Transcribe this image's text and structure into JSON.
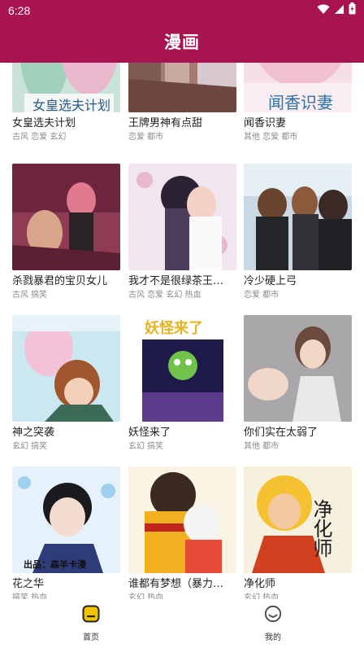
{
  "status": {
    "time": "6:28",
    "wifi_icon": "wifi-icon",
    "signal_icon": "signal-icon",
    "battery_icon": "battery-icon"
  },
  "header": {
    "title": "漫画"
  },
  "colors": {
    "brand": "#a8144f",
    "nav_active": "#f2c400",
    "tag_text": "#8a8a8a"
  },
  "comics": [
    {
      "title": "女皇选夫计划",
      "tags": "古风 恋爱 玄幻"
    },
    {
      "title": "王牌男神有点甜",
      "tags": "恋爱 都市"
    },
    {
      "title": "闻香识妻",
      "tags": "其他 恋爱 都市"
    },
    {
      "title": "杀戮暴君的宝贝女儿",
      "tags": "古风 搞笑"
    },
    {
      "title": "我才不是很绿茶王妃呢",
      "tags": "古风 恋爱 玄幻 热血"
    },
    {
      "title": "冷少硬上弓",
      "tags": "恋爱 都市"
    },
    {
      "title": "神之突袭",
      "tags": "玄幻 搞笑"
    },
    {
      "title": "妖怪来了",
      "tags": "玄幻 搞笑"
    },
    {
      "title": "你们实在太弱了",
      "tags": "其他 都市"
    },
    {
      "title": "花之华",
      "tags": "搞笑 热血"
    },
    {
      "title": "谁都有梦想（暴力兔）",
      "tags": "玄幻 热血"
    },
    {
      "title": "净化师",
      "tags": "玄幻 热血"
    }
  ],
  "covers": {
    "cover_8_text": "妖怪来了",
    "cover_10_text": "出品：森羊卡漫",
    "cover_12_text": "净化师"
  },
  "bottom_nav": [
    {
      "label": "首页",
      "icon": "home-icon",
      "active": true
    },
    {
      "label": "我的",
      "icon": "profile-icon",
      "active": false
    }
  ]
}
